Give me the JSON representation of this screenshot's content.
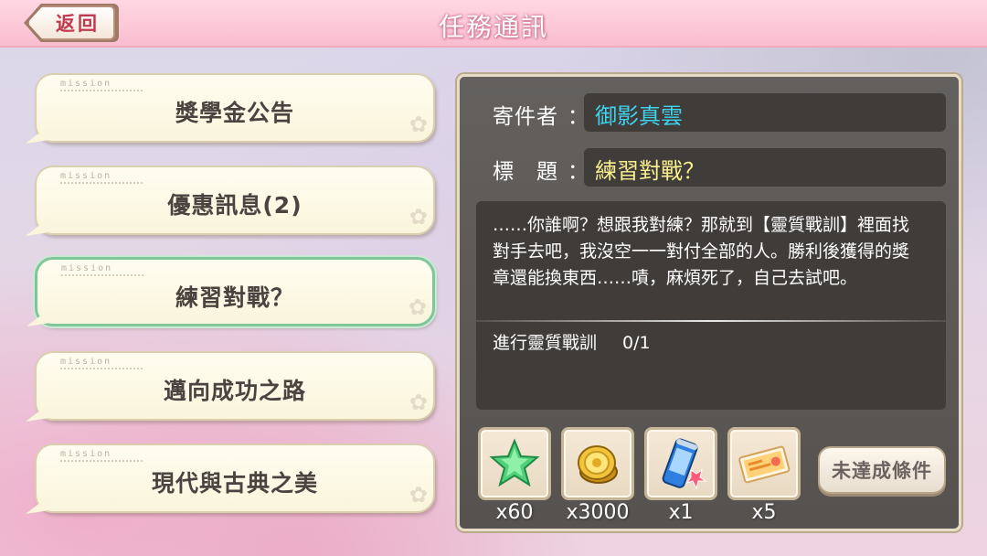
{
  "header": {
    "title": "任務通訊",
    "back_label": "返回"
  },
  "missions": [
    {
      "tag": "mission",
      "label": "獎學金公告",
      "selected": false
    },
    {
      "tag": "mission",
      "label": "優惠訊息(2)",
      "selected": false
    },
    {
      "tag": "mission",
      "label": "練習對戰？",
      "selected": true
    },
    {
      "tag": "mission",
      "label": "邁向成功之路",
      "selected": false
    },
    {
      "tag": "mission",
      "label": "現代與古典之美",
      "selected": false
    }
  ],
  "detail": {
    "sender_label": "寄件者",
    "sender_value": "御影真雲",
    "subject_label": "標　題",
    "subject_value": "練習對戰？",
    "colon": "：",
    "message": "……你誰啊？想跟我對練？那就到【靈質戰訓】裡面找對手去吧，我沒空一一對付全部的人。勝利後獲得的獎章還能換東西……嘖，麻煩死了，自己去試吧。",
    "condition_label": "進行靈質戰訓",
    "condition_progress": "0/1"
  },
  "rewards": [
    {
      "icon": "green-star-icon",
      "count": "x60"
    },
    {
      "icon": "gold-coin-icon",
      "count": "x3000"
    },
    {
      "icon": "blue-can-icon",
      "count": "x1"
    },
    {
      "icon": "ticket-icon",
      "count": "x5"
    }
  ],
  "status_button": "未達成條件",
  "colors": {
    "sender": "#3fd2ef",
    "subject": "#f8ef8e",
    "header": "#f9bdd0",
    "selected_border": "#7fc79a"
  }
}
